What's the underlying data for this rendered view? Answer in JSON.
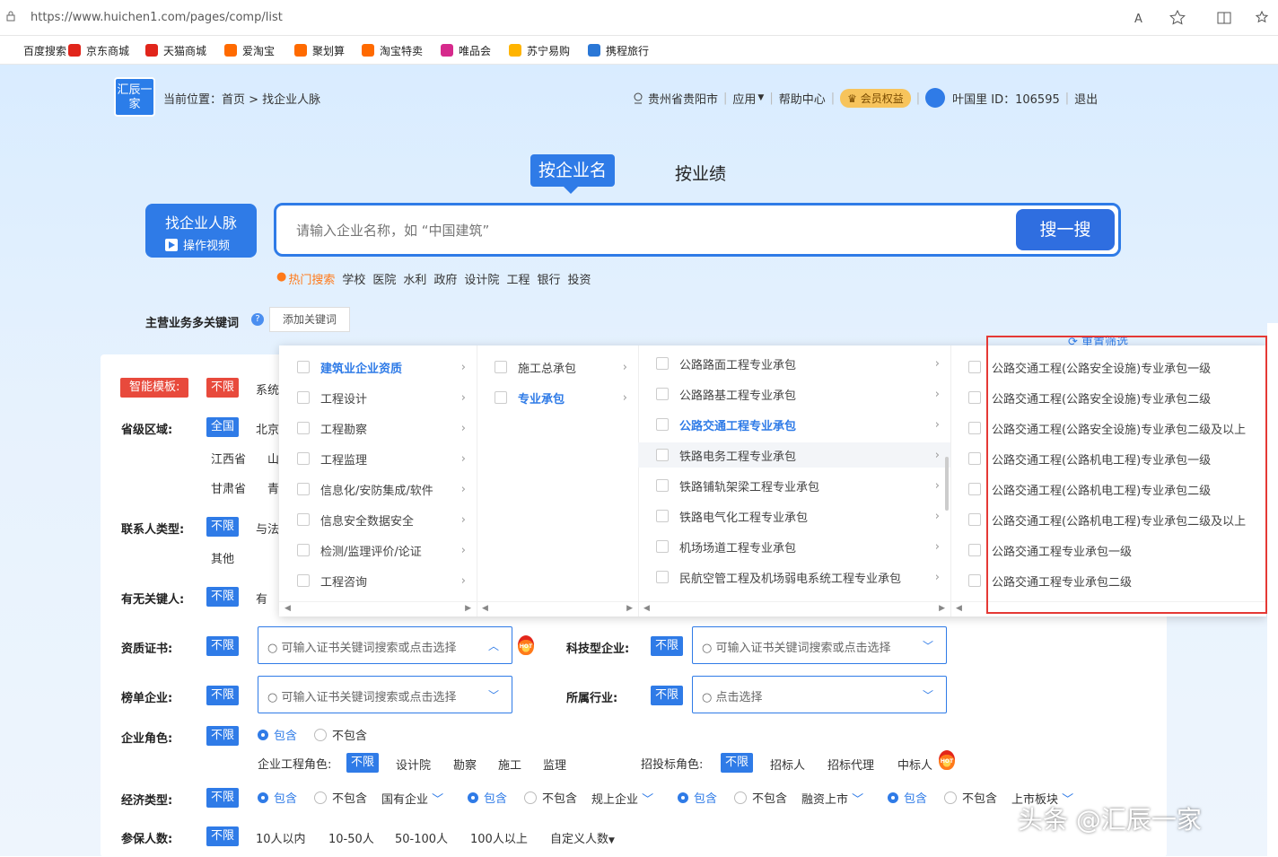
{
  "browser": {
    "url": "https://www.huichen1.com/pages/comp/list",
    "bookmarks": [
      {
        "label": "百度搜索",
        "color": "#fff"
      },
      {
        "label": "京东商城",
        "color": "#e1251b"
      },
      {
        "label": "天猫商城",
        "color": "#e1251b"
      },
      {
        "label": "爱淘宝",
        "color": "#ff6a00"
      },
      {
        "label": "聚划算",
        "color": "#ff6a00"
      },
      {
        "label": "淘宝特卖",
        "color": "#ff6a00"
      },
      {
        "label": "唯品会",
        "color": "#d62a8c"
      },
      {
        "label": "苏宁易购",
        "color": "#ffb400"
      },
      {
        "label": "携程旅行",
        "color": "#2a77d6"
      }
    ]
  },
  "header": {
    "logo": "汇辰一家",
    "breadcrumb": "当前位置：首页 > 找企业人脉",
    "location": "贵州省贵阳市",
    "apps": "应用",
    "help": "帮助中心",
    "vip": "会员权益",
    "user": "叶国里 ID：106595",
    "logout": "退出"
  },
  "tabs": {
    "by_name": "按企业名",
    "by_perf": "按业绩"
  },
  "find": {
    "title": "找企业人脉",
    "video": "操作视频"
  },
  "search": {
    "placeholder": "请输入企业名称，如 “中国建筑”",
    "button": "搜一搜"
  },
  "hot": {
    "label": "热门搜索",
    "items": [
      "学校",
      "医院",
      "水利",
      "政府",
      "设计院",
      "工程",
      "银行",
      "投资"
    ]
  },
  "keywords": {
    "label": "主营业务多关键词",
    "add": "添加关键词"
  },
  "filters": {
    "smart": "智能模板:",
    "unlimited": "不限",
    "system": "系统",
    "province_label": "省级区域:",
    "province_all": "全国",
    "province_items": [
      "北京",
      "江西省",
      "山",
      "甘肃省",
      "青"
    ],
    "contact_label": "联系人类型:",
    "contact_items": [
      "与法",
      "其他"
    ],
    "keyman_label": "有无关键人:",
    "keyman_yes": "有",
    "cert_label": "资质证书:",
    "cert_ph": "可输入证书关键词搜索或点击选择",
    "tech_label": "科技型企业:",
    "tech_ph": "可输入证书关键词搜索或点击选择",
    "rank_label": "榜单企业:",
    "rank_ph": "可输入证书关键词搜索或点击选择",
    "industry_label": "所属行业:",
    "industry_ph": "点击选择",
    "role_label": "企业角色:",
    "include": "包含",
    "exclude": "不包含",
    "eng_role_label": "企业工程角色:",
    "eng_roles": [
      "设计院",
      "勘察",
      "施工",
      "监理"
    ],
    "bid_role_label": "招投标角色:",
    "bid_roles": [
      "招标人",
      "招标代理",
      "中标人"
    ],
    "econ_label": "经济类型:",
    "econ_groups": [
      "国有企业",
      "规上企业",
      "融资上市",
      "上市板块"
    ],
    "insured_label": "参保人数:",
    "insured_items": [
      "10人以内",
      "10-50人",
      "50-100人",
      "100人以上",
      "自定义人数"
    ],
    "hot_badge": "HOT"
  },
  "dropdown": {
    "col1": [
      "建筑业企业资质",
      "工程设计",
      "工程勘察",
      "工程监理",
      "信息化/安防集成/软件",
      "信息安全数据安全",
      "检测/监理评价/论证",
      "工程咨询"
    ],
    "col2": [
      "施工总承包",
      "专业承包"
    ],
    "col3": [
      "公路路面工程专业承包",
      "公路路基工程专业承包",
      "公路交通工程专业承包",
      "铁路电务工程专业承包",
      "铁路铺轨架梁工程专业承包",
      "铁路电气化工程专业承包",
      "机场场道工程专业承包",
      "民航空管工程及机场弱电系统工程专业承包"
    ],
    "col4": [
      "公路交通工程(公路安全设施)专业承包一级",
      "公路交通工程(公路安全设施)专业承包二级",
      "公路交通工程(公路安全设施)专业承包二级及以上",
      "公路交通工程(公路机电工程)专业承包一级",
      "公路交通工程(公路机电工程)专业承包二级",
      "公路交通工程(公路机电工程)专业承包二级及以上",
      "公路交通工程专业承包一级",
      "公路交通工程专业承包二级"
    ],
    "reset": "重置筛选"
  },
  "watermark": "头条 @汇辰一家"
}
